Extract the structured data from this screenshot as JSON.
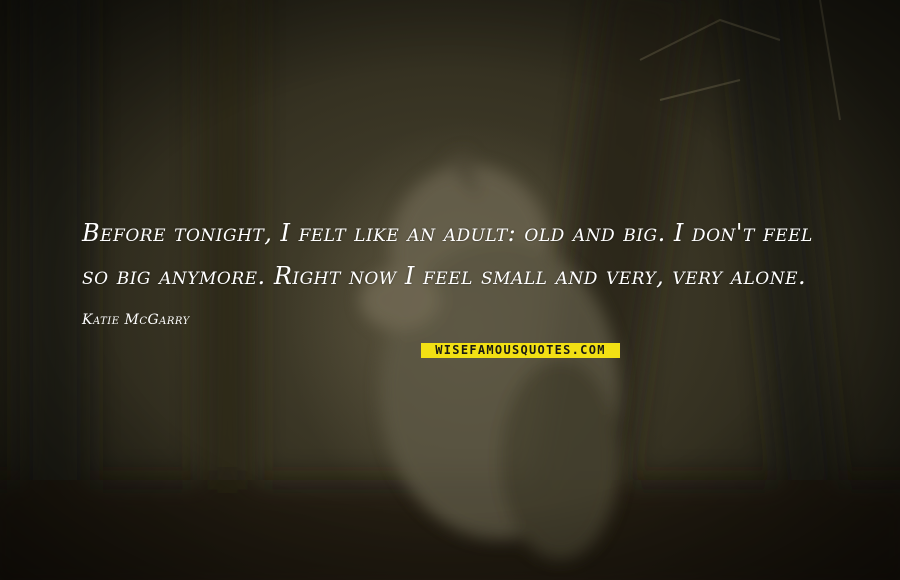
{
  "quote": {
    "text": "Before tonight, I felt like an adult: old and big. I don't feel so big anymore. Right now I feel small and very, very alone.",
    "author": "Katie McGarry"
  },
  "watermark": {
    "label": "WISEFAMOUSQUOTES.COM"
  },
  "colors": {
    "text": "#ffffff",
    "watermark_bg": "#f2e014",
    "background": "#363222"
  }
}
